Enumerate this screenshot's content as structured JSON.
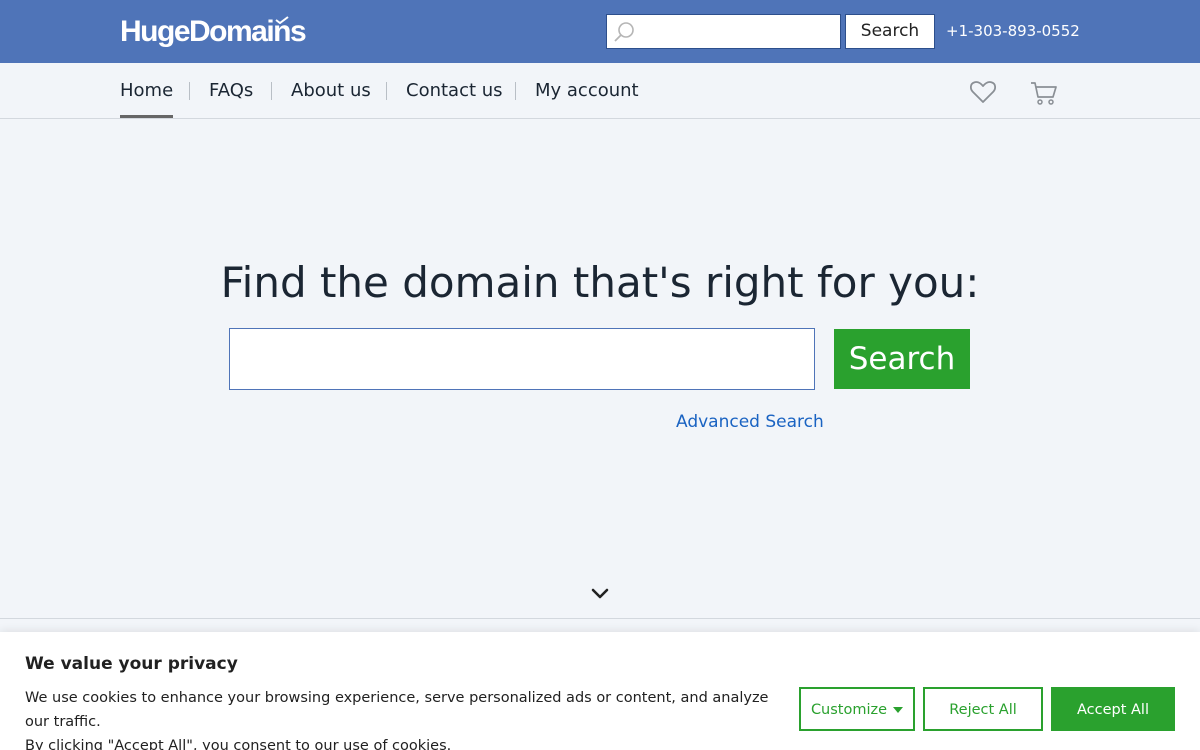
{
  "header": {
    "logo_text": "HugeDomains",
    "search": {
      "placeholder": "",
      "value": "",
      "icon": "search-icon"
    },
    "search_button": "Search",
    "phone": "+1-303-893-0552",
    "colors": {
      "bar": "#4f74b8"
    }
  },
  "nav": {
    "items": [
      {
        "label": "Home",
        "active": true
      },
      {
        "label": "FAQs"
      },
      {
        "label": "About us"
      },
      {
        "label": "Contact us"
      },
      {
        "label": "My account"
      }
    ],
    "icons": [
      "heart-icon",
      "cart-icon"
    ]
  },
  "hero": {
    "title": "Find the domain that's right for you:",
    "search_value": "",
    "search_button": "Search",
    "advanced_link": "Advanced Search",
    "scroll_icon": "chevron-down-icon",
    "colors": {
      "button": "#2aa12e",
      "link": "#1a63c2"
    }
  },
  "cookie": {
    "title": "We value your privacy",
    "text_line1": "We use cookies to enhance your browsing experience, serve personalized ads or content, and analyze our traffic.",
    "text_line2": "By clicking \"Accept All\", you consent to our use of cookies.",
    "customize": "Customize",
    "reject": "Reject All",
    "accept": "Accept All"
  }
}
